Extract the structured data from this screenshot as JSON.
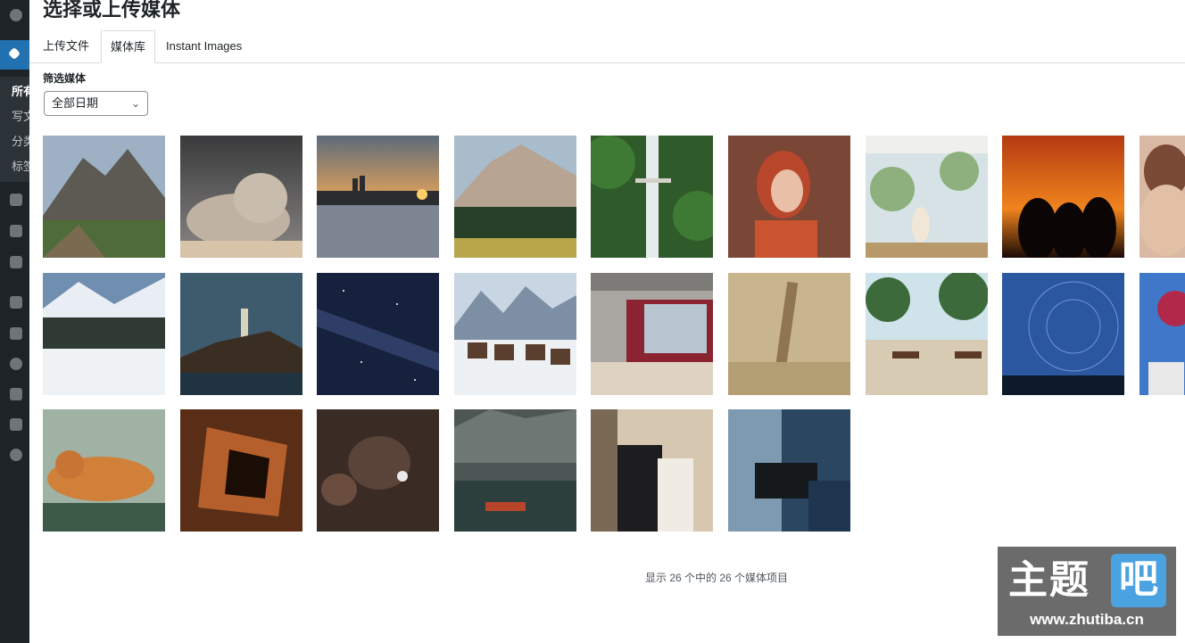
{
  "sidebar": {
    "items": [
      "所有",
      "写文",
      "分类",
      "标签"
    ]
  },
  "modal": {
    "title": "选择或上传媒体",
    "tabs": [
      {
        "label": "上传文件"
      },
      {
        "label": "媒体库"
      },
      {
        "label": "Instant Images"
      }
    ],
    "filter": {
      "label": "筛选媒体",
      "selected": "全部日期"
    },
    "status": "显示 26 个中的 26 个媒体项目"
  },
  "watermark": {
    "text": "主题",
    "badge": "吧",
    "url": "www.zhutiba.cn"
  },
  "colors": {
    "accent": "#2271b1",
    "sidebar": "#1d2327"
  }
}
